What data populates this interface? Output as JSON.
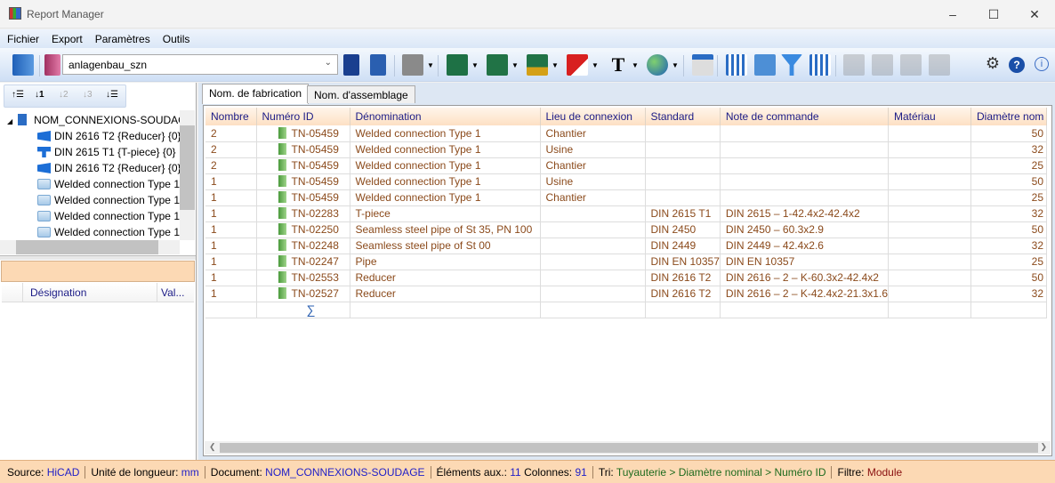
{
  "window": {
    "title": "Report Manager"
  },
  "menu": [
    "Fichier",
    "Export",
    "Paramètres",
    "Outils"
  ],
  "toolbar": {
    "config_value": "anlagenbau_szn"
  },
  "tree": {
    "root": "NOM_CONNEXIONS-SOUDAGE",
    "items": [
      {
        "label": "DIN 2616 T2 {Reducer} {0}",
        "icon": "reducer-icon"
      },
      {
        "label": "DIN 2615 T1 {T-piece} {0}",
        "icon": "tee-icon"
      },
      {
        "label": "DIN 2616 T2 {Reducer} {0}",
        "icon": "reducer-icon"
      },
      {
        "label": "Welded connection Type 1",
        "icon": "folder-icon"
      },
      {
        "label": "Welded connection Type 1",
        "icon": "folder-icon"
      },
      {
        "label": "Welded connection Type 1",
        "icon": "folder-icon"
      },
      {
        "label": "Welded connection Type 1",
        "icon": "folder-icon"
      }
    ]
  },
  "properties": {
    "columns": [
      "Désignation",
      "Val..."
    ]
  },
  "tabs": [
    "Nom. de fabrication",
    "Nom. d'assemblage"
  ],
  "table": {
    "columns": [
      "Nombre",
      "Numéro ID",
      "Dénomination",
      "Lieu de connexion",
      "Standard",
      "Note de commande",
      "Matériau",
      "Diamètre nom"
    ],
    "rows": [
      [
        "2",
        "TN-05459",
        "Welded connection Type 1",
        "Chantier",
        "",
        "",
        "",
        "50"
      ],
      [
        "2",
        "TN-05459",
        "Welded connection Type 1",
        "Usine",
        "",
        "",
        "",
        "32"
      ],
      [
        "2",
        "TN-05459",
        "Welded connection Type 1",
        "Chantier",
        "",
        "",
        "",
        "25"
      ],
      [
        "1",
        "TN-05459",
        "Welded connection Type 1",
        "Usine",
        "",
        "",
        "",
        "50"
      ],
      [
        "1",
        "TN-05459",
        "Welded connection Type 1",
        "Chantier",
        "",
        "",
        "",
        "25"
      ],
      [
        "1",
        "TN-02283",
        "T-piece",
        "",
        "DIN 2615 T1",
        "DIN 2615 – 1-42.4x2-42.4x2",
        "",
        "32"
      ],
      [
        "1",
        "TN-02250",
        "Seamless steel pipe of St 35, PN 100",
        "",
        "DIN 2450",
        "DIN 2450 – 60.3x2.9",
        "",
        "50"
      ],
      [
        "1",
        "TN-02248",
        "Seamless steel pipe of St 00",
        "",
        "DIN 2449",
        "DIN 2449 – 42.4x2.6",
        "",
        "32"
      ],
      [
        "1",
        "TN-02247",
        "Pipe",
        "",
        "DIN EN 10357",
        "DIN EN 10357",
        "",
        "25"
      ],
      [
        "1",
        "TN-02553",
        "Reducer",
        "",
        "DIN 2616 T2",
        "DIN 2616 – 2 – K-60.3x2-42.4x2",
        "",
        "50"
      ],
      [
        "1",
        "TN-02527",
        "Reducer",
        "",
        "DIN 2616 T2",
        "DIN 2616 – 2 – K-42.4x2-21.3x1.6",
        "",
        "32"
      ]
    ],
    "sum_symbol": "∑"
  },
  "status": {
    "source_label": "Source:",
    "source": "HiCAD",
    "unit_label": "Unité de longueur:",
    "unit": "mm",
    "doc_label": "Document:",
    "doc": "NOM_CONNEXIONS-SOUDAGE",
    "aux_label": "Éléments aux.:",
    "aux": "11",
    "cols_label": "Colonnes:",
    "cols": "91",
    "sort_label": "Tri:",
    "sort": "Tuyauterie > Diamètre nominal > Numéro ID",
    "filter_label": "Filtre:",
    "filter": "Module"
  }
}
